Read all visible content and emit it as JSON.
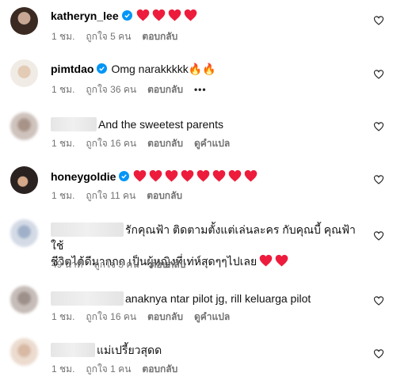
{
  "comments": [
    {
      "username": "katheryn_lee",
      "verified": true,
      "text": "",
      "hearts": 4,
      "time": "1 ชม.",
      "likes": "ถูกใจ 5 คน",
      "reply": "ตอบกลับ",
      "translate": "",
      "more": ""
    },
    {
      "username": "pimtdao",
      "verified": true,
      "text": "Omg narakkkkk🔥🔥",
      "hearts": 0,
      "time": "1 ชม.",
      "likes": "ถูกใจ 36 คน",
      "reply": "ตอบกลับ",
      "translate": "",
      "more": "•••"
    },
    {
      "username": "",
      "verified": false,
      "text": "And the sweetest parents",
      "hearts": 0,
      "time": "1 ชม.",
      "likes": "ถูกใจ 16 คน",
      "reply": "ตอบกลับ",
      "translate": "ดูคำแปล",
      "more": ""
    },
    {
      "username": "honeygoldie",
      "verified": true,
      "text": "",
      "hearts": 8,
      "time": "1 ชม.",
      "likes": "ถูกใจ 11 คน",
      "reply": "ตอบกลับ",
      "translate": "",
      "more": ""
    },
    {
      "username": "",
      "verified": false,
      "text_line1": "รักคุณฟ้า ติดตามตั้งแต่เล่นละคร กับคุณบี้ คุณฟ้าใช้",
      "text_line2": "ชีวิตได้ดีมากกก เป็นผู้หญิงที่เท่ห์สุดๆๆไปเลย",
      "hearts": 2,
      "time": "49 นาที",
      "likes": "ถูกใจ 3 คน",
      "reply": "ตอบกลับ",
      "translate": "",
      "more": ""
    },
    {
      "username": "",
      "verified": false,
      "text": "anaknya ntar pilot jg, rill keluarga pilot",
      "hearts": 0,
      "time": "1 ชม.",
      "likes": "ถูกใจ 16 คน",
      "reply": "ตอบกลับ",
      "translate": "ดูคำแปล",
      "more": ""
    },
    {
      "username": "",
      "verified": false,
      "text": "แม่เปรี้ยวสุดด",
      "hearts": 0,
      "time": "1 ชม.",
      "likes": "ถูกใจ 1 คน",
      "reply": "ตอบกลับ",
      "translate": "",
      "more": ""
    }
  ],
  "colors": {
    "heart": "#ed1c3c",
    "verified": "#0095f6",
    "meta": "#737373"
  },
  "icons": {
    "like": "heart-outline-icon",
    "verified": "verified-badge-icon"
  }
}
